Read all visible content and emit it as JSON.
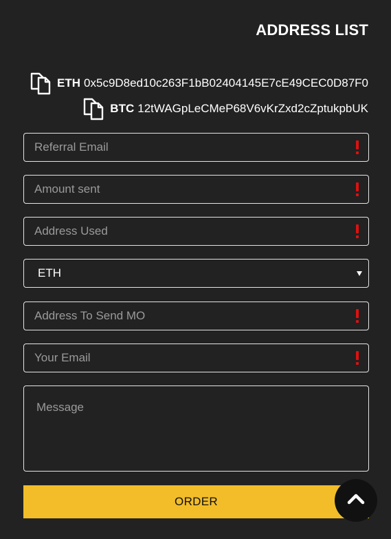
{
  "header": {
    "title": "ADDRESS LIST"
  },
  "addresses": [
    {
      "coin": "ETH",
      "address": "0x5c9D8ed10c263F1bB02404145E7cE49CEC0D87F0",
      "icon": "copy-icon"
    },
    {
      "coin": "BTC",
      "address": "12tWAGpLeCMeP68V6vKrZxd2cZptukpbUK",
      "icon": "copy-icon"
    }
  ],
  "form": {
    "referral_email": {
      "placeholder": "Referral Email",
      "required_icon": "exclamation-icon"
    },
    "amount_sent": {
      "placeholder": "Amount sent",
      "required_icon": "exclamation-icon"
    },
    "address_used": {
      "placeholder": "Address Used",
      "required_icon": "exclamation-icon"
    },
    "currency_select": {
      "selected": "ETH",
      "icon": "caret-down-icon"
    },
    "address_to_send": {
      "placeholder": "Address To Send MO",
      "required_icon": "exclamation-icon"
    },
    "your_email": {
      "placeholder": "Your Email",
      "required_icon": "exclamation-icon"
    },
    "message": {
      "placeholder": "Message"
    },
    "order_label": "ORDER"
  },
  "scroll_top": {
    "icon": "chevron-up-icon"
  },
  "colors": {
    "background": "#222222",
    "accent": "#f2bd28",
    "required": "#e01010",
    "border": "#e6e6e6",
    "placeholder": "#9a9a9a"
  }
}
